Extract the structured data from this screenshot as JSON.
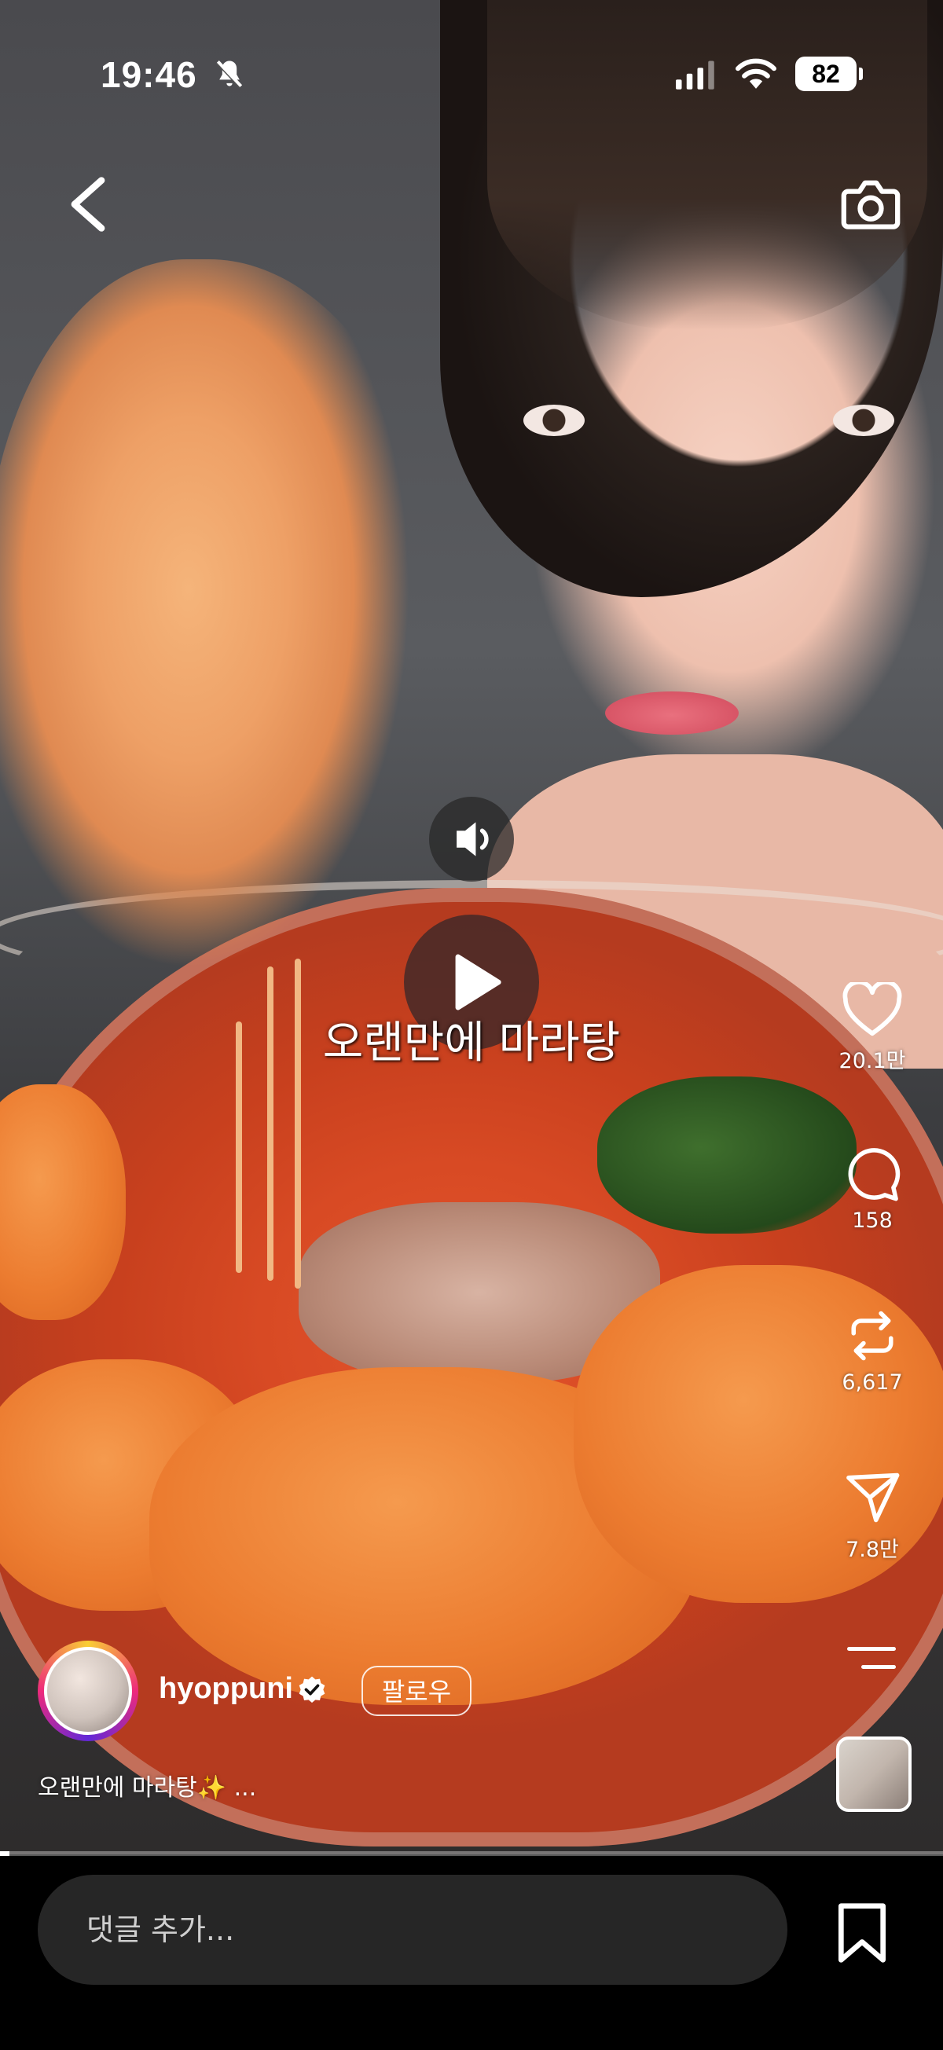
{
  "status_bar": {
    "time": "19:46",
    "battery": "82",
    "icons": [
      "bell-slash-icon",
      "signal-icon",
      "wifi-icon",
      "battery-icon"
    ]
  },
  "top_bar": {
    "back_icon": "chevron-left-icon",
    "camera_icon": "camera-icon"
  },
  "video": {
    "caption": "오랜만에 마라탕",
    "sound_icon": "speaker-icon",
    "play_icon": "play-icon",
    "progress": 0.01
  },
  "actions": {
    "like_count": "20.1만",
    "comment_count": "158",
    "repost_count": "6,617",
    "share_count": "7.8만",
    "more_icon": "menu-icon"
  },
  "author": {
    "username": "hyoppuni",
    "verified": true,
    "follow_label": "팔로우",
    "description": "오랜만에 마라탕✨ ..."
  },
  "bottom_bar": {
    "comment_placeholder": "댓글 추가...",
    "bookmark_icon": "bookmark-icon"
  },
  "colors": {
    "background": "#000000",
    "comment_field": "#262626",
    "text": "#ffffff"
  }
}
